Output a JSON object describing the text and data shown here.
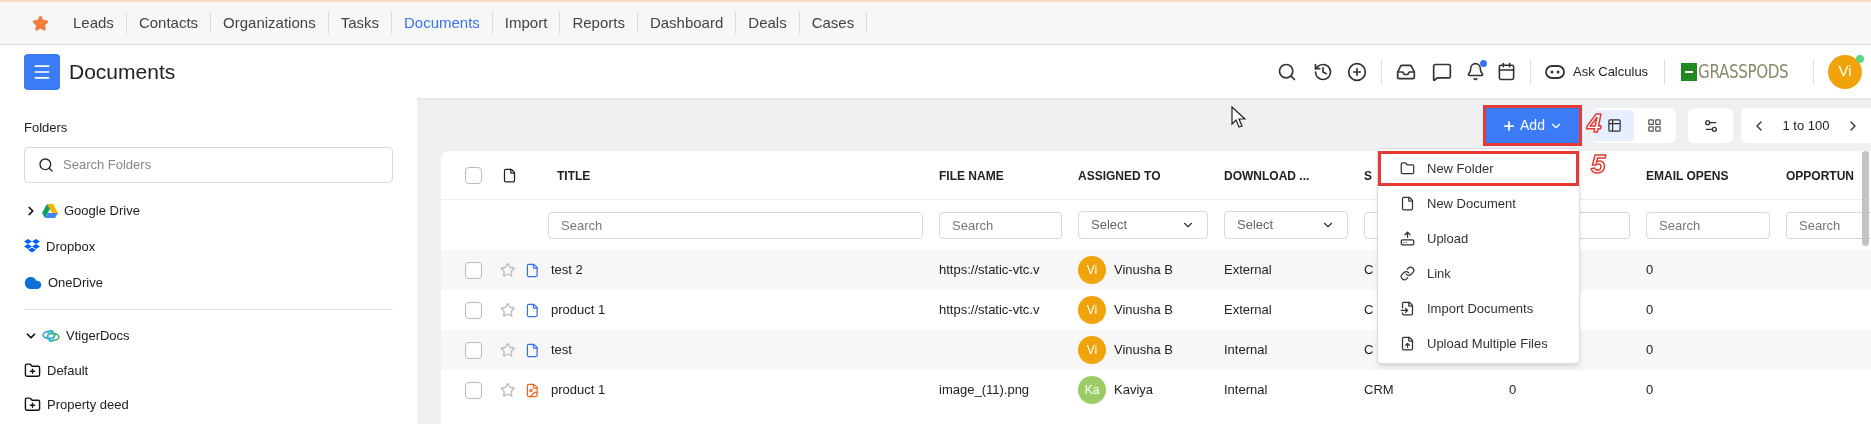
{
  "tabs": [
    {
      "label": "Leads",
      "selected": false
    },
    {
      "label": "Contacts",
      "selected": false
    },
    {
      "label": "Organizations",
      "selected": false
    },
    {
      "label": "Tasks",
      "selected": false
    },
    {
      "label": "Documents",
      "selected": true
    },
    {
      "label": "Import",
      "selected": false
    },
    {
      "label": "Reports",
      "selected": false
    },
    {
      "label": "Dashboard",
      "selected": false
    },
    {
      "label": "Deals",
      "selected": false
    },
    {
      "label": "Cases",
      "selected": false
    }
  ],
  "header": {
    "title": "Documents",
    "notification_badge": true,
    "assistant": "Ask Calculus",
    "logo": "GRASSPODS",
    "avatar": {
      "initials": "Vi",
      "online": true
    }
  },
  "sidebar": {
    "heading": "Folders",
    "search": {
      "placeholder": "Search Folders"
    },
    "items": [
      {
        "kind": "google_drive",
        "label": "Google Drive",
        "expanded": false
      },
      {
        "kind": "dropbox",
        "label": "Dropbox"
      },
      {
        "kind": "onedrive",
        "label": "OneDrive"
      },
      {
        "kind": "vtiger",
        "label": "VtigerDocs",
        "expanded": true,
        "children": [
          {
            "kind": "folder",
            "label": "Default"
          },
          {
            "kind": "folder",
            "label": "Property deed"
          }
        ]
      }
    ]
  },
  "toolbar": {
    "add_button": {
      "label": "Add",
      "highlighted": true
    },
    "views": [
      {
        "kind": "list",
        "selected": true
      },
      {
        "kind": "grid",
        "selected": false
      }
    ],
    "pagination": "1 to 100"
  },
  "table": {
    "select_all_checked": false,
    "columns": [
      {
        "label": "TITLE",
        "filter": {
          "kind": "search",
          "placeholder": "Search"
        }
      },
      {
        "label": "FILE NAME",
        "filter": {
          "kind": "search",
          "placeholder": "Search"
        }
      },
      {
        "label": "ASSIGNED TO",
        "filter": {
          "kind": "select",
          "placeholder": "Select"
        }
      },
      {
        "label": "DOWNLOAD ...",
        "filter": {
          "kind": "select",
          "placeholder": "Select"
        }
      },
      {
        "label": "S",
        "filter": {
          "kind": "search"
        }
      },
      {
        "filter": {
          "kind": "search"
        }
      },
      {
        "label": "EMAIL OPENS",
        "filter": {
          "kind": "search",
          "placeholder": "Search"
        }
      },
      {
        "label": "OPPORTUN",
        "filter": {
          "kind": "search",
          "placeholder": "Search"
        }
      }
    ],
    "rows": [
      {
        "kind": "document",
        "checked": false,
        "title": "test 2",
        "file_name": "https://static-vtc.v",
        "assigned": {
          "initials": "Vi",
          "name": "Vinusha B",
          "color": "#f0a30a"
        },
        "download": "External",
        "column_5": "C",
        "email_opens": "0"
      },
      {
        "kind": "document",
        "checked": false,
        "title": "product 1",
        "file_name": "https://static-vtc.v",
        "assigned": {
          "initials": "Vi",
          "name": "Vinusha B",
          "color": "#f0a30a"
        },
        "download": "External",
        "column_5": "C",
        "email_opens": "0"
      },
      {
        "kind": "document",
        "checked": false,
        "title": "test",
        "assigned": {
          "initials": "Vi",
          "name": "Vinusha B",
          "color": "#f0a30a"
        },
        "download": "Internal",
        "column_5": "C",
        "email_opens": "0"
      },
      {
        "kind": "image",
        "checked": false,
        "title": "product 1",
        "file_name": "image_(11).png",
        "assigned": {
          "initials": "Ka",
          "name": "Kaviya",
          "color": "#9ccc65"
        },
        "download": "Internal",
        "column_5": "CRM",
        "column_6": "0",
        "email_opens": "0"
      }
    ]
  },
  "add_menu": {
    "items": [
      {
        "kind": "folder",
        "label": "New Folder",
        "highlighted": true
      },
      {
        "kind": "document",
        "label": "New Document",
        "highlighted": false
      },
      {
        "kind": "upload",
        "label": "Upload",
        "highlighted": false
      },
      {
        "kind": "link",
        "label": "Link",
        "highlighted": false
      },
      {
        "kind": "import",
        "label": "Import Documents",
        "highlighted": false
      },
      {
        "kind": "upload_multiple",
        "label": "Upload Multiple Files",
        "highlighted": false
      }
    ]
  },
  "annotations": [
    {
      "label": "4"
    },
    {
      "label": "5"
    }
  ]
}
